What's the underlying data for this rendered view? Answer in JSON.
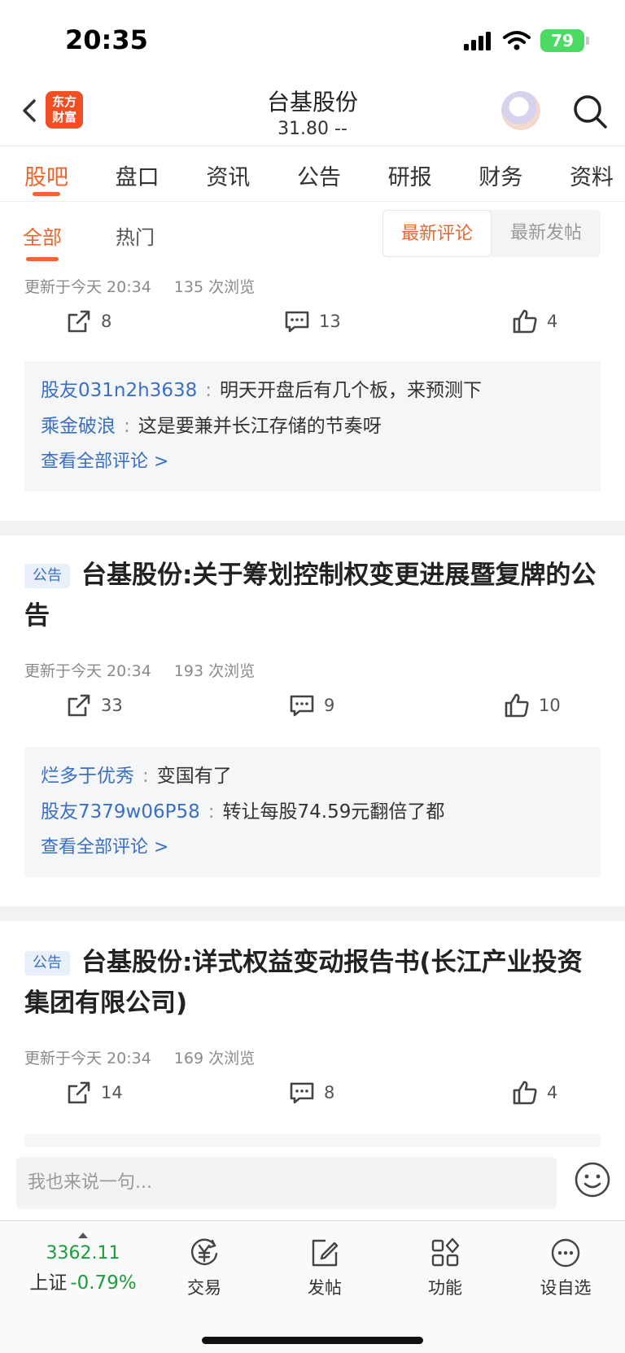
{
  "status_bar": {
    "time": "20:35",
    "battery": "79"
  },
  "header": {
    "logo_line1": "东方",
    "logo_line2": "财富",
    "title": "台基股份",
    "price": "31.80  --"
  },
  "main_tabs": [
    "股吧",
    "盘口",
    "资讯",
    "公告",
    "研报",
    "财务",
    "资料"
  ],
  "sub_tabs": {
    "all": "全部",
    "hot": "热门",
    "sort_latest_comment": "最新评论",
    "sort_latest_post": "最新发帖"
  },
  "posts": [
    {
      "meta_time": "更新于今天 20:34",
      "meta_views": "135 次浏览",
      "shares": "8",
      "comments": "13",
      "likes": "4",
      "comment_list": [
        {
          "user": "股友031n2h3638",
          "text": "明天开盘后有几个板，来预测下"
        },
        {
          "user": "乘金破浪",
          "text": "这是要兼并长江存储的节奏呀"
        }
      ],
      "view_all": "查看全部评论 >"
    },
    {
      "badge": "公告",
      "title": "台基股份:关于筹划控制权变更进展暨复牌的公告",
      "meta_time": "更新于今天 20:34",
      "meta_views": "193 次浏览",
      "shares": "33",
      "comments": "9",
      "likes": "10",
      "comment_list": [
        {
          "user": "烂多于优秀",
          "text": "变国有了"
        },
        {
          "user": "股友7379w06P58",
          "text": "转让每股74.59元翻倍了都"
        }
      ],
      "view_all": "查看全部评论 >"
    },
    {
      "badge": "公告",
      "title": "台基股份:详式权益变动报告书(长江产业投资集团有限公司)",
      "meta_time": "更新于今天 20:34",
      "meta_views": "169 次浏览",
      "shares": "14",
      "comments": "8",
      "likes": "4"
    }
  ],
  "input": {
    "placeholder": "我也来说一句..."
  },
  "bottom_nav": {
    "index_value": "3362.11",
    "index_name": "上证",
    "index_change": "-0.79%",
    "items": [
      "交易",
      "发帖",
      "功能",
      "设自选"
    ]
  },
  "colors": {
    "accent": "#f0642b",
    "link": "#3a6fc4",
    "down": "#1a9e3c",
    "logo": "#f04e23"
  }
}
